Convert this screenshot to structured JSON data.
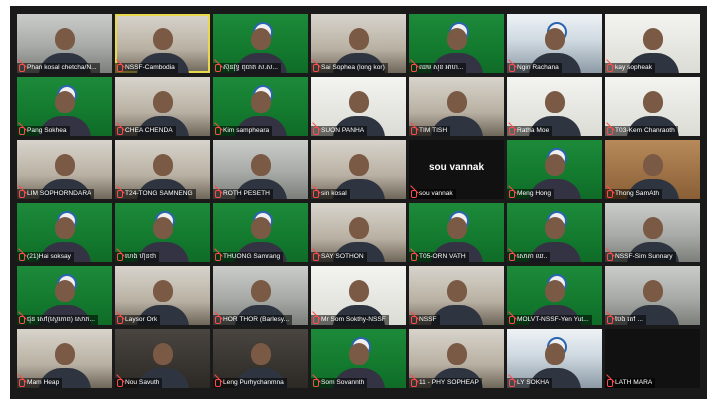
{
  "participants": [
    {
      "name": "Phan kosal chetcha/N...",
      "bg": "bg-office"
    },
    {
      "name": "NSSF-Cambodia",
      "bg": "bg-room",
      "active": true
    },
    {
      "name": "ស៊ុនវុទ្ធី ពុធាត ស.ស...",
      "bg": "bg-green"
    },
    {
      "name": "Sai Sophea (long kor)",
      "bg": "bg-room"
    },
    {
      "name": "ឈឹម សុខ អាហ...",
      "bg": "bg-green"
    },
    {
      "name": "Ngin Rachana",
      "bg": "bg-banner"
    },
    {
      "name": "kay sopheak",
      "bg": "bg-white"
    },
    {
      "name": "Pang Sokhea",
      "bg": "bg-green"
    },
    {
      "name": "CHEA CHENDA",
      "bg": "bg-room"
    },
    {
      "name": "Kim sampheara",
      "bg": "bg-green"
    },
    {
      "name": "SUON PANHA",
      "bg": "bg-white"
    },
    {
      "name": "TIM TISH",
      "bg": "bg-room"
    },
    {
      "name": "Ratha Moe",
      "bg": "bg-white"
    },
    {
      "name": "T03-Kem Chanraoth",
      "bg": "bg-white"
    },
    {
      "name": "LIM SOPHORNDARA",
      "bg": "bg-room"
    },
    {
      "name": "T24-TONG SAMNENG",
      "bg": "bg-room"
    },
    {
      "name": "ROTH PESETH",
      "bg": "bg-office"
    },
    {
      "name": "sin kosal",
      "bg": "bg-room"
    },
    {
      "name": "sou vannak",
      "bg": "bg-black",
      "center": "sou vannak"
    },
    {
      "name": "Meng Hong",
      "bg": "bg-green"
    },
    {
      "name": "Thong SamAth",
      "bg": "bg-wood"
    },
    {
      "name": "(21)Hai soksay",
      "bg": "bg-green"
    },
    {
      "name": "ហេង ហ៊ុនថា",
      "bg": "bg-green"
    },
    {
      "name": "THUONG Samrang",
      "bg": "bg-green"
    },
    {
      "name": "SAY SOTHON",
      "bg": "bg-room"
    },
    {
      "name": "T05-ORN VATH",
      "bg": "bg-green"
    },
    {
      "name": "សោភា ឈ..",
      "bg": "bg-green"
    },
    {
      "name": "NSSF-Sim Sunnary",
      "bg": "bg-office"
    },
    {
      "name": "ជុន សៅ(ស្ថេរភាព) សោភ...",
      "bg": "bg-green"
    },
    {
      "name": "Laysor Ork",
      "bg": "bg-room"
    },
    {
      "name": "HOR THOR (Barlesy...",
      "bg": "bg-office"
    },
    {
      "name": "Mr Som Sokthy-NSSF",
      "bg": "bg-white"
    },
    {
      "name": "NSSF",
      "bg": "bg-room"
    },
    {
      "name": "MOLVT-NSSF-Yen Yut...",
      "bg": "bg-green"
    },
    {
      "name": "ប៉ែង តៅ ...",
      "bg": "bg-office"
    },
    {
      "name": "Mam Heap",
      "bg": "bg-room"
    },
    {
      "name": "Nou Savuth",
      "bg": "bg-dark"
    },
    {
      "name": "Leng Purhychanmna",
      "bg": "bg-dark"
    },
    {
      "name": "Som Sovannth",
      "bg": "bg-green"
    },
    {
      "name": "11 - PHY SOPHEAP",
      "bg": "bg-room"
    },
    {
      "name": "LY SOKHA",
      "bg": "bg-banner"
    },
    {
      "name": "LATH MARA",
      "bg": "bg-black"
    }
  ],
  "colors": {
    "muted_mic": "#ff4b4b",
    "active_speaker": "#e8d84a"
  }
}
